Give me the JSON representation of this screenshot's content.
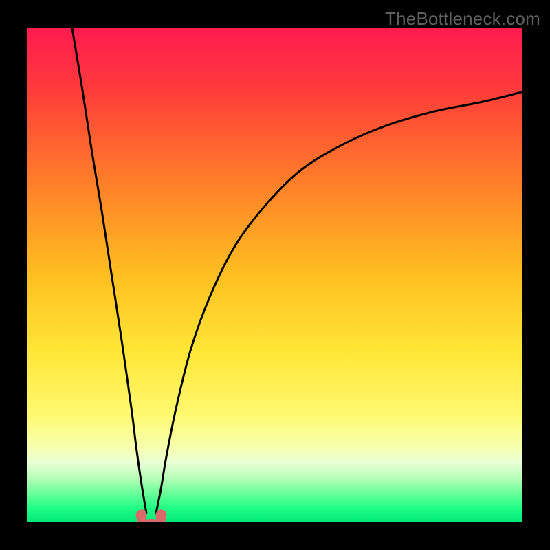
{
  "watermark": {
    "text": "TheBottleneck.com"
  },
  "chart_data": {
    "type": "line",
    "title": "",
    "xlabel": "",
    "ylabel": "",
    "xlim": [
      0,
      100
    ],
    "ylim": [
      0,
      100
    ],
    "grid": false,
    "gradient_stops": [
      {
        "offset": 0.0,
        "color": "#ff1a50"
      },
      {
        "offset": 0.12,
        "color": "#ff3a3a"
      },
      {
        "offset": 0.3,
        "color": "#ff7a2a"
      },
      {
        "offset": 0.5,
        "color": "#ffbf1f"
      },
      {
        "offset": 0.65,
        "color": "#ffe635"
      },
      {
        "offset": 0.78,
        "color": "#fff96e"
      },
      {
        "offset": 0.85,
        "color": "#f6ffb0"
      },
      {
        "offset": 0.88,
        "color": "#e8ffd6"
      },
      {
        "offset": 0.91,
        "color": "#b8ffb8"
      },
      {
        "offset": 0.94,
        "color": "#6cff9a"
      },
      {
        "offset": 0.97,
        "color": "#20ff85"
      },
      {
        "offset": 1.0,
        "color": "#00e87a"
      }
    ],
    "minimum_x": 25,
    "series": [
      {
        "name": "bottleneck-curve-left",
        "x": [
          9,
          11,
          13,
          15,
          17,
          19,
          21,
          22,
          23,
          24
        ],
        "values": [
          100,
          88,
          75,
          63,
          50,
          37,
          23,
          15,
          8,
          2
        ]
      },
      {
        "name": "bottleneck-curve-right",
        "x": [
          26,
          27,
          28,
          30,
          33,
          37,
          42,
          48,
          55,
          63,
          72,
          82,
          92,
          100
        ],
        "values": [
          2,
          7,
          13,
          23,
          35,
          46,
          56,
          64,
          71,
          76,
          80,
          83,
          85,
          87
        ]
      }
    ],
    "floor_marker": {
      "x_range": [
        23,
        27
      ],
      "y": 1.5,
      "color": "#d96a6a"
    }
  }
}
